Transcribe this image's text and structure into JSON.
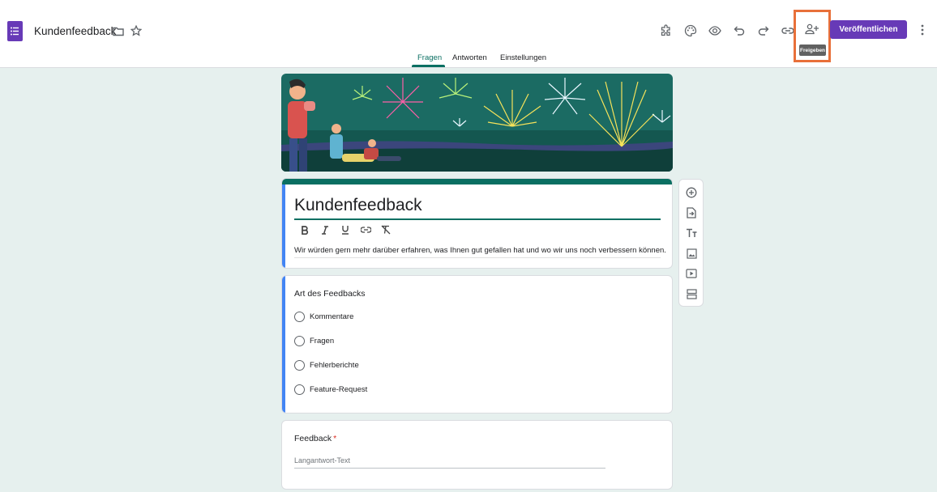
{
  "header": {
    "doc_title": "Kundenfeedback",
    "publish_label": "Veröffentlichen",
    "share_tooltip": "Freigeben",
    "brand_color": "#673ab7",
    "highlight_color": "#e8703a",
    "toolbar_icons": [
      "add-ons-icon",
      "palette-icon",
      "preview-icon",
      "undo-icon",
      "redo-icon",
      "link-icon",
      "share-person-add-icon",
      "more-vert-icon"
    ]
  },
  "tabs": [
    {
      "label": "Fragen",
      "active": true
    },
    {
      "label": "Antworten",
      "active": false
    },
    {
      "label": "Einstellungen",
      "active": false
    }
  ],
  "form": {
    "title": "Kundenfeedback",
    "description": "Wir würden gern mehr darüber erfahren, was Ihnen gut gefallen hat und wo wir uns noch verbessern können.",
    "format_icons": [
      "bold-icon",
      "italic-icon",
      "underline-icon",
      "link-icon",
      "clear-format-icon"
    ],
    "theme_color": "#0a6f62"
  },
  "questions": [
    {
      "title": "Art des Feedbacks",
      "type": "multiple-choice",
      "options": [
        "Kommentare",
        "Fragen",
        "Fehlerberichte",
        "Feature-Request"
      ]
    },
    {
      "title": "Feedback",
      "required_marker": "*",
      "type": "paragraph",
      "placeholder": "Langantwort-Text"
    }
  ],
  "side_toolbar": [
    "add-question-icon",
    "import-questions-icon",
    "add-title-icon",
    "add-image-icon",
    "add-video-icon",
    "add-section-icon"
  ]
}
